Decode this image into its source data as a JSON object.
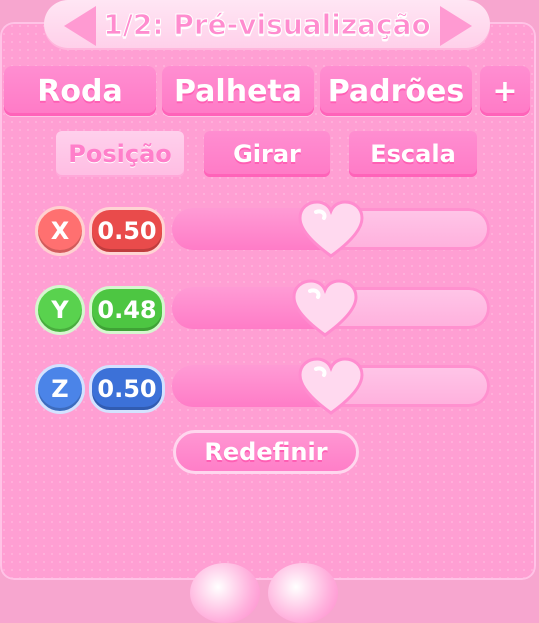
{
  "header": {
    "title": "1/2: Pré-visualização"
  },
  "tabs": [
    {
      "label": "Roda"
    },
    {
      "label": "Palheta"
    },
    {
      "label": "Padrões"
    },
    {
      "label": "+"
    }
  ],
  "subtabs": [
    {
      "label": "Posição",
      "active": true
    },
    {
      "label": "Girar",
      "active": false
    },
    {
      "label": "Escala",
      "active": false
    }
  ],
  "axes": [
    {
      "axis": "X",
      "value_text": "0.50",
      "value": 0.5,
      "color": "#ff7070"
    },
    {
      "axis": "Y",
      "value_text": "0.48",
      "value": 0.48,
      "color": "#59d24e"
    },
    {
      "axis": "Z",
      "value_text": "0.50",
      "value": 0.5,
      "color": "#4b84e8"
    }
  ],
  "reset": {
    "label": "Redefinir"
  },
  "icons": {
    "prev": "chevron-left-icon",
    "next": "chevron-right-icon",
    "slider_handle": "heart-icon"
  },
  "colors": {
    "accent": "#ff8ccf",
    "panel": "#ff9fd3"
  }
}
